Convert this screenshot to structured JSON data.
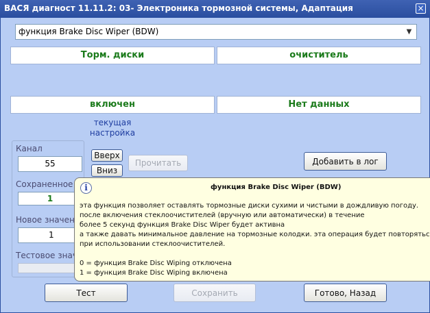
{
  "window": {
    "title": "ВАСЯ диагност 11.11.2: 03- Электроника тормозной системы, Адаптация",
    "close_label": "×"
  },
  "function_select": {
    "value": "функция Brake Disc Wiper (BDW)",
    "arrow": "▼"
  },
  "grid": {
    "row1": [
      "Торм. диски",
      "очиститель"
    ],
    "row2": [
      "включен",
      "Нет данных"
    ],
    "current_setting_label": "текущая настройка"
  },
  "channel": {
    "label": "Канал",
    "value": "55",
    "up_label": "Вверх",
    "down_label": "Вниз"
  },
  "read_button": "Прочитать",
  "add_to_log_button": "Добавить в лог",
  "saved_value": {
    "label": "Сохраненное з",
    "value": "1"
  },
  "new_value": {
    "label": "Новое значени",
    "value": "1"
  },
  "test_value": {
    "label": "Тестовое знач",
    "value": ""
  },
  "tooltip": {
    "icon": "i",
    "title": "функция Brake Disc Wiper (BDW)",
    "lines": [
      "эта функция позволяет оставлять тормозные диски сухими и чистыми в дождливую погоду.",
      "после включения стеклоочистителей (вручную или автоматически) в течение",
      " более 5 секунд функция Brake Disc Wiper будет активна",
      "а также давать минимальное давление на тормозные колодки. эта операция будет повторяться ка",
      "при использовании стеклоочистителей.",
      "",
      "0 = функция Brake Disc Wiping отключена",
      "1 = функция Brake Disc Wiping включена"
    ]
  },
  "buttons": {
    "test": "Тест",
    "save": "Сохранить",
    "done": "Готово, Назад"
  }
}
